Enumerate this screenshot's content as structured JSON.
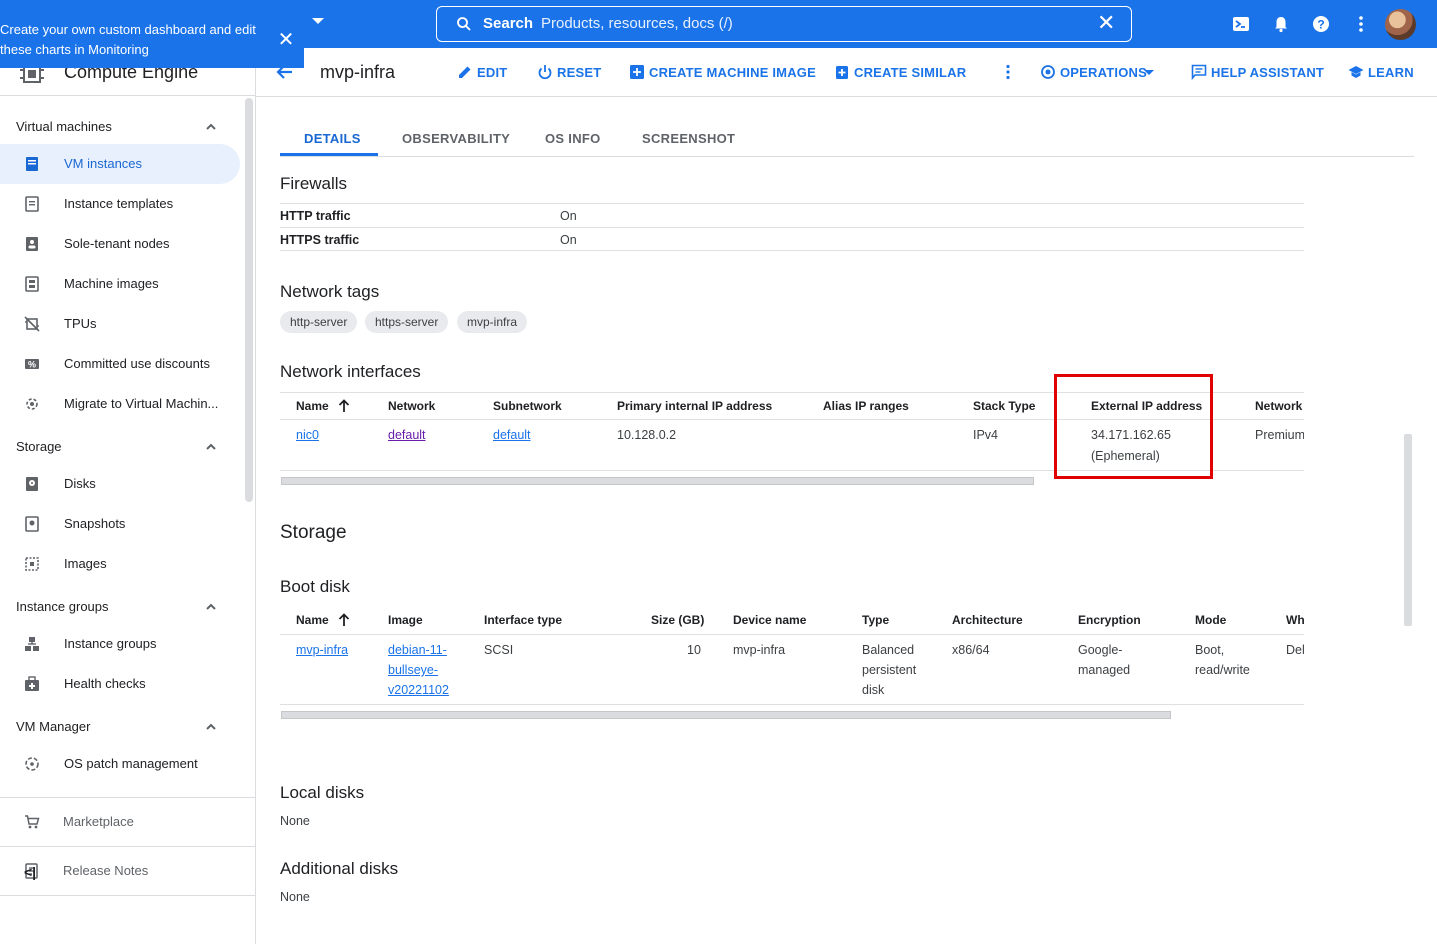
{
  "tooltip": {
    "text": "Create your own custom dashboard and edit these charts in Monitoring",
    "close_icon": "close-icon"
  },
  "search": {
    "label": "Search",
    "placeholder": "Products, resources, docs (/)"
  },
  "topbar_icons": [
    "cloud-shell-icon",
    "notifications-icon",
    "help-icon",
    "more-vert-icon",
    "avatar"
  ],
  "sidebar": {
    "title": "Compute Engine",
    "sections": [
      {
        "label": "Virtual machines",
        "items": [
          "VM instances",
          "Instance templates",
          "Sole-tenant nodes",
          "Machine images",
          "TPUs",
          "Committed use discounts",
          "Migrate to Virtual Machin..."
        ]
      },
      {
        "label": "Storage",
        "items": [
          "Disks",
          "Snapshots",
          "Images"
        ]
      },
      {
        "label": "Instance groups",
        "items": [
          "Instance groups",
          "Health checks"
        ]
      },
      {
        "label": "VM Manager",
        "items": [
          "OS patch management"
        ]
      }
    ],
    "active_item": "VM instances",
    "footer": {
      "marketplace": "Marketplace",
      "release_notes": "Release Notes",
      "collapse": "<|"
    }
  },
  "actionbar": {
    "title": "mvp-infra",
    "edit": "EDIT",
    "reset": "RESET",
    "create_machine_image": "CREATE MACHINE IMAGE",
    "create_similar": "CREATE SIMILAR",
    "operations": "OPERATIONS",
    "help_assistant": "HELP ASSISTANT",
    "learn": "LEARN"
  },
  "tabs": [
    "DETAILS",
    "OBSERVABILITY",
    "OS INFO",
    "SCREENSHOT"
  ],
  "firewalls": {
    "heading": "Firewalls",
    "rows": [
      {
        "key": "HTTP traffic",
        "value": "On"
      },
      {
        "key": "HTTPS traffic",
        "value": "On"
      }
    ]
  },
  "network_tags": {
    "heading": "Network tags",
    "tags": [
      "http-server",
      "https-server",
      "mvp-infra"
    ]
  },
  "network_interfaces": {
    "heading": "Network interfaces",
    "columns": [
      "Name",
      "Network",
      "Subnetwork",
      "Primary internal IP address",
      "Alias IP ranges",
      "Stack Type",
      "External IP address",
      "Network t"
    ],
    "rows": [
      {
        "name": "nic0",
        "network": "default",
        "subnetwork": "default",
        "internal_ip": "10.128.0.2",
        "alias": "",
        "stack": "IPv4",
        "external_ip": "34.171.162.65",
        "external_note": "(Ephemeral)",
        "tier": "Premium"
      }
    ]
  },
  "storage": {
    "heading": "Storage",
    "boot_disk": {
      "heading": "Boot disk",
      "columns": [
        "Name",
        "Image",
        "Interface type",
        "Size (GB)",
        "Device name",
        "Type",
        "Architecture",
        "Encryption",
        "Mode",
        "Wh"
      ],
      "rows": [
        {
          "name": "mvp-infra",
          "image": [
            "debian-11-",
            "bullseye-",
            "v20221102"
          ],
          "interface": "SCSI",
          "size": "10",
          "device": "mvp-infra",
          "type": [
            "Balanced",
            "persistent",
            "disk"
          ],
          "arch": "x86/64",
          "encryption": [
            "Google-",
            "managed"
          ],
          "mode": [
            "Boot,",
            "read/write"
          ],
          "when": "Del"
        }
      ]
    },
    "local_disks": {
      "heading": "Local disks",
      "value": "None"
    },
    "additional_disks": {
      "heading": "Additional disks",
      "value": "None"
    }
  }
}
